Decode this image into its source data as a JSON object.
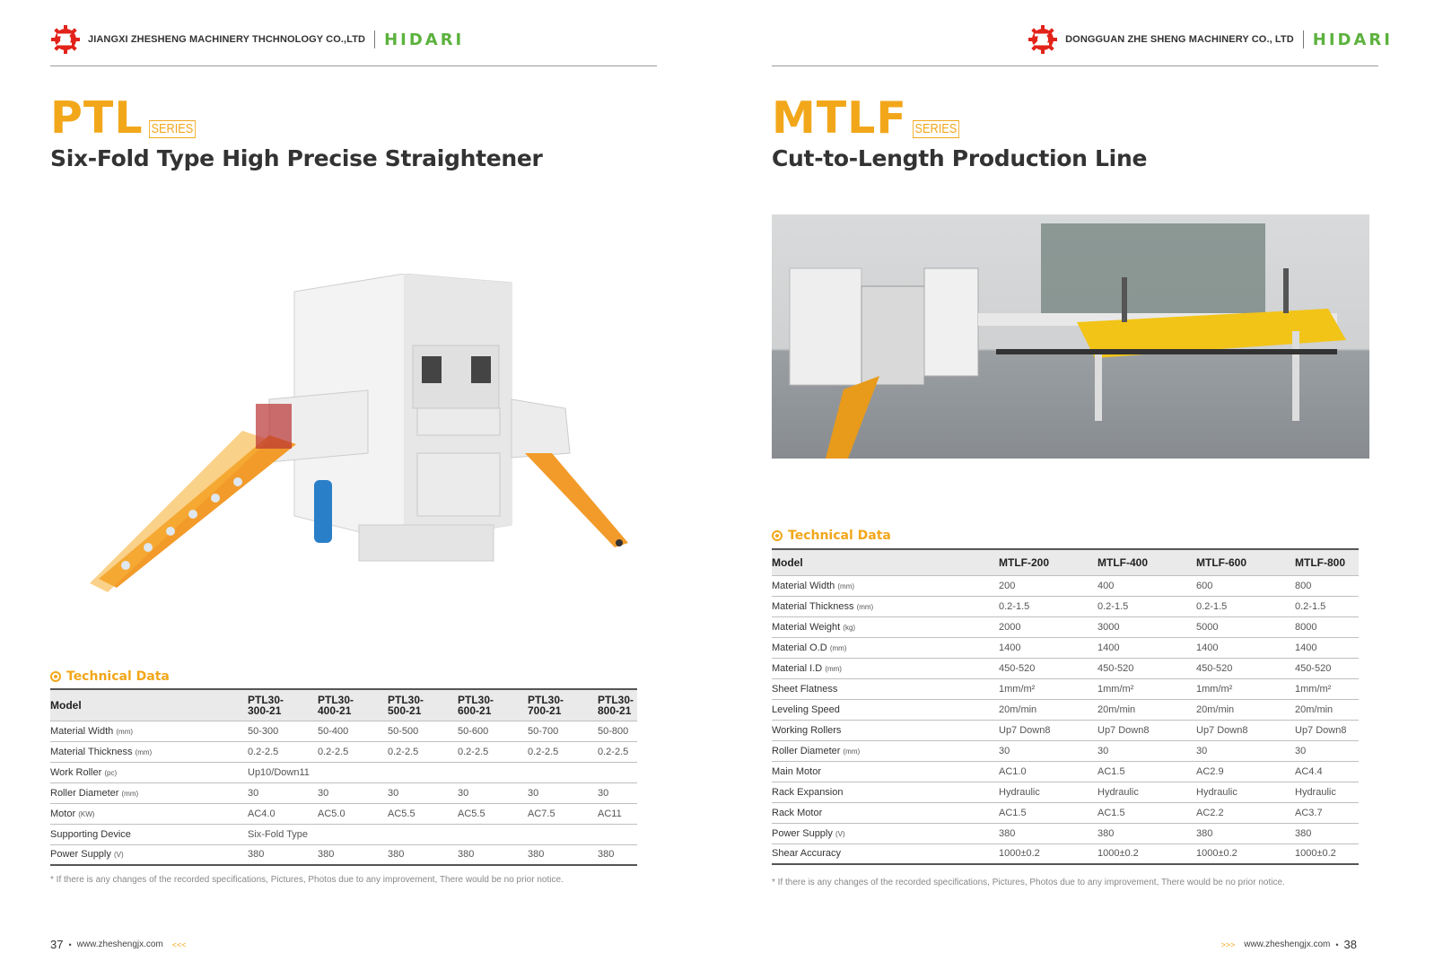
{
  "left": {
    "company": "JIANGXI ZHESHENG MACHINERY THCHNOLOGY CO.,LTD",
    "brand": "HIDARI",
    "series_code": "PTL",
    "series_tag": "SERIES",
    "subtitle": "Six-Fold Type High Precise Straightener",
    "tech_title": "Technical Data",
    "table": {
      "header": [
        "Model",
        "PTL30-\n300-21",
        "PTL30-\n400-21",
        "PTL30-\n500-21",
        "PTL30-\n600-21",
        "PTL30-\n700-21",
        "PTL30-\n800-21"
      ],
      "rows": [
        {
          "label": "Material Width",
          "unit": "(mm)",
          "values": [
            "50-300",
            "50-400",
            "50-500",
            "50-600",
            "50-700",
            "50-800"
          ]
        },
        {
          "label": "Material Thickness",
          "unit": "(mm)",
          "values": [
            "0.2-2.5",
            "0.2-2.5",
            "0.2-2.5",
            "0.2-2.5",
            "0.2-2.5",
            "0.2-2.5"
          ]
        },
        {
          "label": "Work Roller",
          "unit": "(pc)",
          "span": "Up10/Down11"
        },
        {
          "label": "Roller Diameter",
          "unit": "(mm)",
          "values": [
            "30",
            "30",
            "30",
            "30",
            "30",
            "30"
          ]
        },
        {
          "label": "Motor",
          "unit": "(KW)",
          "values": [
            "AC4.0",
            "AC5.0",
            "AC5.5",
            "AC5.5",
            "AC7.5",
            "AC11"
          ]
        },
        {
          "label": "Supporting Device",
          "unit": "",
          "span": "Six-Fold Type"
        },
        {
          "label": "Power Supply",
          "unit": "(V)",
          "values": [
            "380",
            "380",
            "380",
            "380",
            "380",
            "380"
          ]
        }
      ]
    },
    "note": "* If there is any changes of the recorded specifications, Pictures, Photos due to any improvement, There would be no prior notice.",
    "page_number": "37",
    "website": "www.zheshengjx.com",
    "arrows": "<<<"
  },
  "right": {
    "company": "DONGGUAN ZHE SHENG MACHINERY CO., LTD",
    "brand": "HIDARI",
    "series_code": "MTLF",
    "series_tag": "SERIES",
    "subtitle": "Cut-to-Length Production Line",
    "tech_title": "Technical Data",
    "table": {
      "header": [
        "Model",
        "MTLF-200",
        "MTLF-400",
        "MTLF-600",
        "MTLF-800"
      ],
      "rows": [
        {
          "label": "Material Width",
          "unit": "(mm)",
          "values": [
            "200",
            "400",
            "600",
            "800"
          ]
        },
        {
          "label": "Material Thickness",
          "unit": "(mm)",
          "values": [
            "0.2-1.5",
            "0.2-1.5",
            "0.2-1.5",
            "0.2-1.5"
          ]
        },
        {
          "label": "Material Weight",
          "unit": "(kg)",
          "values": [
            "2000",
            "3000",
            "5000",
            "8000"
          ]
        },
        {
          "label": "Material O.D",
          "unit": "(mm)",
          "values": [
            "1400",
            "1400",
            "1400",
            "1400"
          ]
        },
        {
          "label": "Material I.D",
          "unit": "(mm)",
          "values": [
            "450-520",
            "450-520",
            "450-520",
            "450-520"
          ]
        },
        {
          "label": "Sheet Flatness",
          "unit": "",
          "values": [
            "1mm/m²",
            "1mm/m²",
            "1mm/m²",
            "1mm/m²"
          ]
        },
        {
          "label": "Leveling Speed",
          "unit": "",
          "values": [
            "20m/min",
            "20m/min",
            "20m/min",
            "20m/min"
          ]
        },
        {
          "label": "Working Rollers",
          "unit": "",
          "values": [
            "Up7 Down8",
            "Up7 Down8",
            "Up7 Down8",
            "Up7 Down8"
          ]
        },
        {
          "label": "Roller Diameter",
          "unit": "(mm)",
          "values": [
            "30",
            "30",
            "30",
            "30"
          ]
        },
        {
          "label": "Main Motor",
          "unit": "",
          "values": [
            "AC1.0",
            "AC1.5",
            "AC2.9",
            "AC4.4"
          ]
        },
        {
          "label": "Rack Expansion",
          "unit": "",
          "values": [
            "Hydraulic",
            "Hydraulic",
            "Hydraulic",
            "Hydraulic"
          ]
        },
        {
          "label": "Rack Motor",
          "unit": "",
          "values": [
            "AC1.5",
            "AC1.5",
            "AC2.2",
            "AC3.7"
          ]
        },
        {
          "label": "Power Supply",
          "unit": "(V)",
          "values": [
            "380",
            "380",
            "380",
            "380"
          ]
        },
        {
          "label": "Shear Accuracy",
          "unit": "",
          "values": [
            "1000±0.2",
            "1000±0.2",
            "1000±0.2",
            "1000±0.2"
          ]
        }
      ]
    },
    "note": "* If there is any changes of the recorded specifications, Pictures, Photos due to any improvement, There would be no prior notice.",
    "page_number": "38",
    "website": "www.zheshengjx.com",
    "arrows": ">>>"
  },
  "colors": {
    "accent": "#f2a71b",
    "brand_green": "#5cb23d",
    "logo_red": "#e2231a"
  },
  "icons": {
    "logo": "gear-logo-icon",
    "tech": "circle-target-icon"
  }
}
